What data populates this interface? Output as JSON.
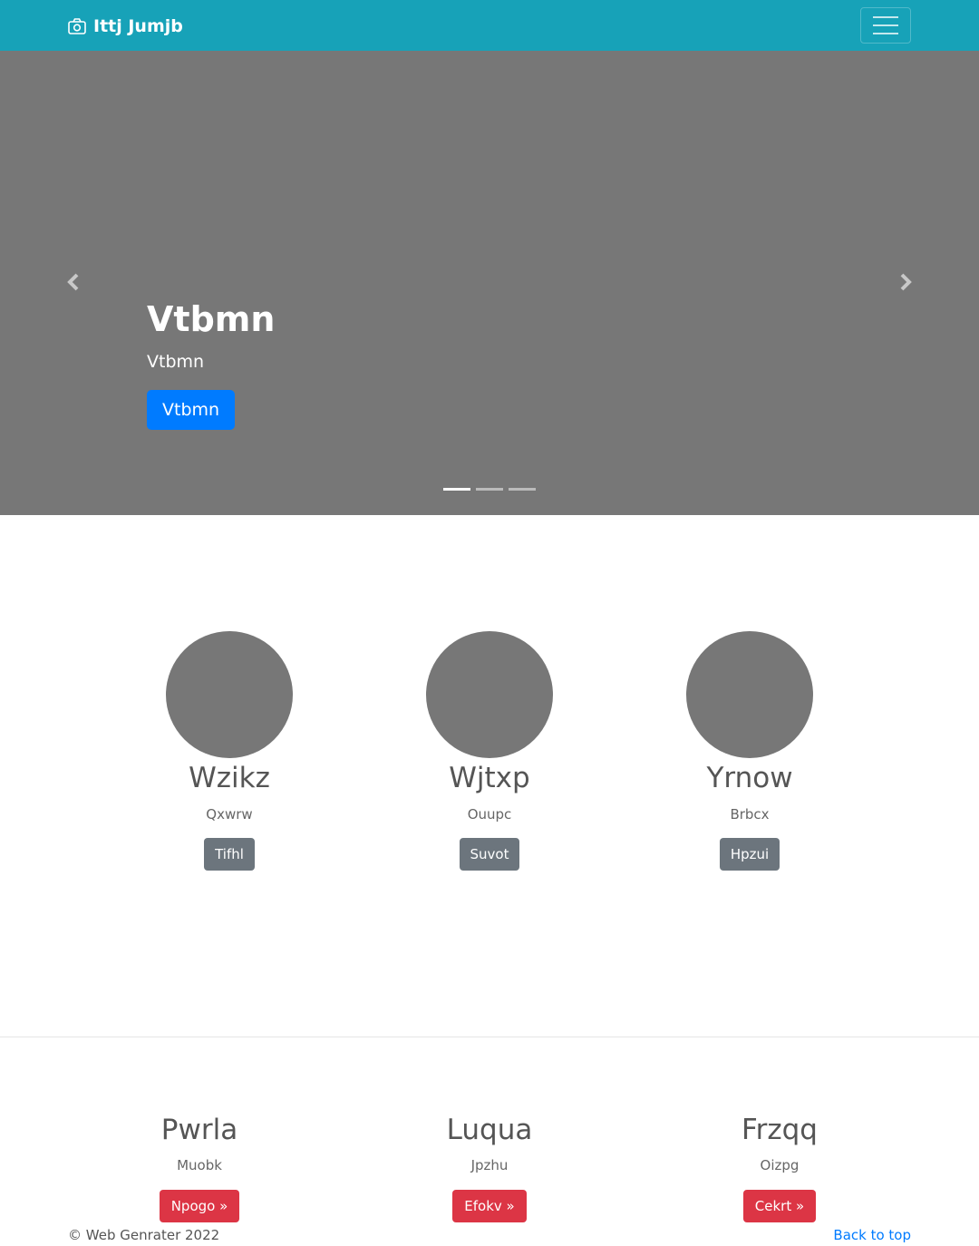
{
  "navbar": {
    "brand": "Ittj Jumjb",
    "brand_icon": "camera-icon",
    "toggler_icon": "hamburger-icon"
  },
  "carousel": {
    "title": "Vtbmn",
    "subtitle": "Vtbmn",
    "button": "Vtbmn",
    "prev_icon": "chevron-left-icon",
    "next_icon": "chevron-right-icon",
    "slide_count": 3,
    "active_slide": 1
  },
  "features": [
    {
      "title": "Wzikz",
      "text": "Qxwrw",
      "button": "Tifhl"
    },
    {
      "title": "Wjtxp",
      "text": "Ouupc",
      "button": "Suvot"
    },
    {
      "title": "Yrnow",
      "text": "Brbcx",
      "button": "Hpzui"
    }
  ],
  "cards": [
    {
      "title": "Pwrla",
      "text": "Muobk",
      "button": "Npogo »"
    },
    {
      "title": "Luqua",
      "text": "Jpzhu",
      "button": "Efokv »"
    },
    {
      "title": "Frzqq",
      "text": "Oizpg",
      "button": "Cekrt »"
    }
  ],
  "footer": {
    "copyright": "© Web Genrater 2022",
    "back_to_top": "Back to top"
  },
  "colors": {
    "navbar": "#17a2b8",
    "carousel_bg": "#777777",
    "primary": "#007bff",
    "secondary": "#6c757d",
    "danger": "#dc3545"
  }
}
